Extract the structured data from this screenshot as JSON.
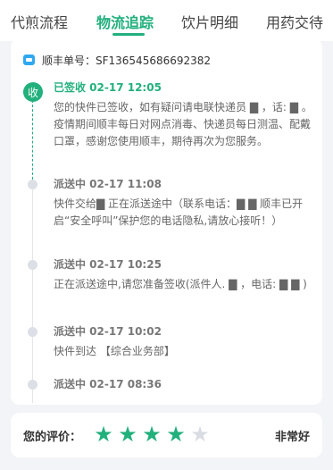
{
  "tabs": [
    {
      "label": "代煎流程",
      "active": false
    },
    {
      "label": "物流追踪",
      "active": true
    },
    {
      "label": "饮片明细",
      "active": false
    },
    {
      "label": "用药交待",
      "active": false
    }
  ],
  "waybill": {
    "label": "顺丰单号：SF136545686692382"
  },
  "events": [
    {
      "badge": "收",
      "title": "已签收  02-17  12:05",
      "body": "您的快件已签收，如有疑问请电联快递员 ▇ ，话: ▇ 。疫情期间顺丰每日对网点消毒、快递员每日测温、配戴口罩，感谢您使用顺丰，期待再次为您服务。"
    },
    {
      "title": "派送中  02-17  11:08",
      "body": "快件交给▇ 正在派送途中（联系电话：▇ ▇ 顺丰已开启“安全呼叫”保护您的电话隐私,请放心接听！）"
    },
    {
      "title": "派送中  02-17  10:25",
      "body": "正在派送途中,请您准备签收(派件人. ▇ ，电话: ▇ ▇ )"
    },
    {
      "title": "派送中  02-17  10:02",
      "body": "快件到达 【综合业务部】"
    },
    {
      "title": "派送中  02-17  08:36",
      "body": ""
    }
  ],
  "rating": {
    "label": "您的评价：",
    "value": 4,
    "max": 5,
    "text": "非常好"
  },
  "colors": {
    "accent": "#22b07d",
    "star_off": "#d9dde3"
  }
}
